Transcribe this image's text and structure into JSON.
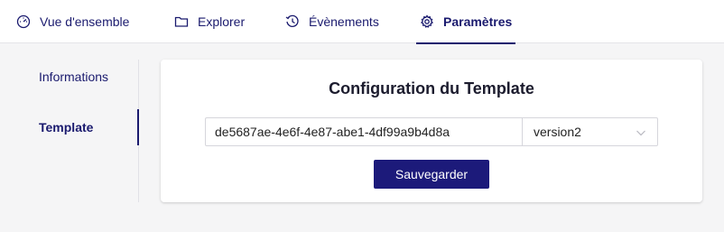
{
  "tabs": [
    {
      "label": "Vue d'ensemble",
      "icon": "dashboard-icon"
    },
    {
      "label": "Explorer",
      "icon": "folder-icon"
    },
    {
      "label": "Évènements",
      "icon": "history-icon"
    },
    {
      "label": "Paramètres",
      "icon": "gear-icon",
      "active": true
    }
  ],
  "sidebar": {
    "items": [
      {
        "label": "Informations"
      },
      {
        "label": "Template",
        "active": true
      }
    ]
  },
  "config": {
    "title": "Configuration du Template",
    "template_id": "de5687ae-4e6f-4e87-abe1-4df99a9b4d8a",
    "version": "version2",
    "save_label": "Sauvegarder"
  },
  "colors": {
    "primary": "#1c1a7a",
    "tab_text": "#1a1a6e",
    "background": "#f5f5f6"
  }
}
